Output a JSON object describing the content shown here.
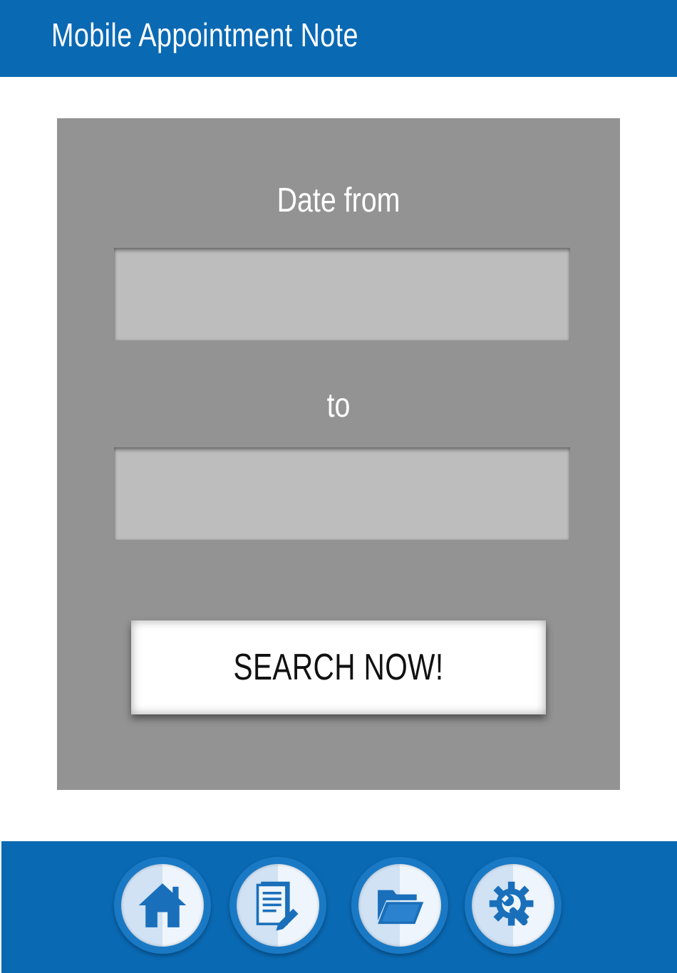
{
  "header": {
    "title": "Mobile Appointment Note"
  },
  "form": {
    "date_from_label": "Date from",
    "date_from_value": "",
    "to_label": "to",
    "date_to_value": "",
    "search_label": "SEARCH NOW!"
  },
  "nav": {
    "items": [
      {
        "name": "home",
        "icon": "home-icon"
      },
      {
        "name": "notes",
        "icon": "document-edit-icon"
      },
      {
        "name": "folder",
        "icon": "folder-open-icon"
      },
      {
        "name": "settings",
        "icon": "gear-wrench-icon"
      }
    ]
  },
  "colors": {
    "primary": "#0a69b3",
    "panel": "#939393",
    "field": "#bdbdbd",
    "button": "#ffffff",
    "icon": "#1a6fba"
  }
}
